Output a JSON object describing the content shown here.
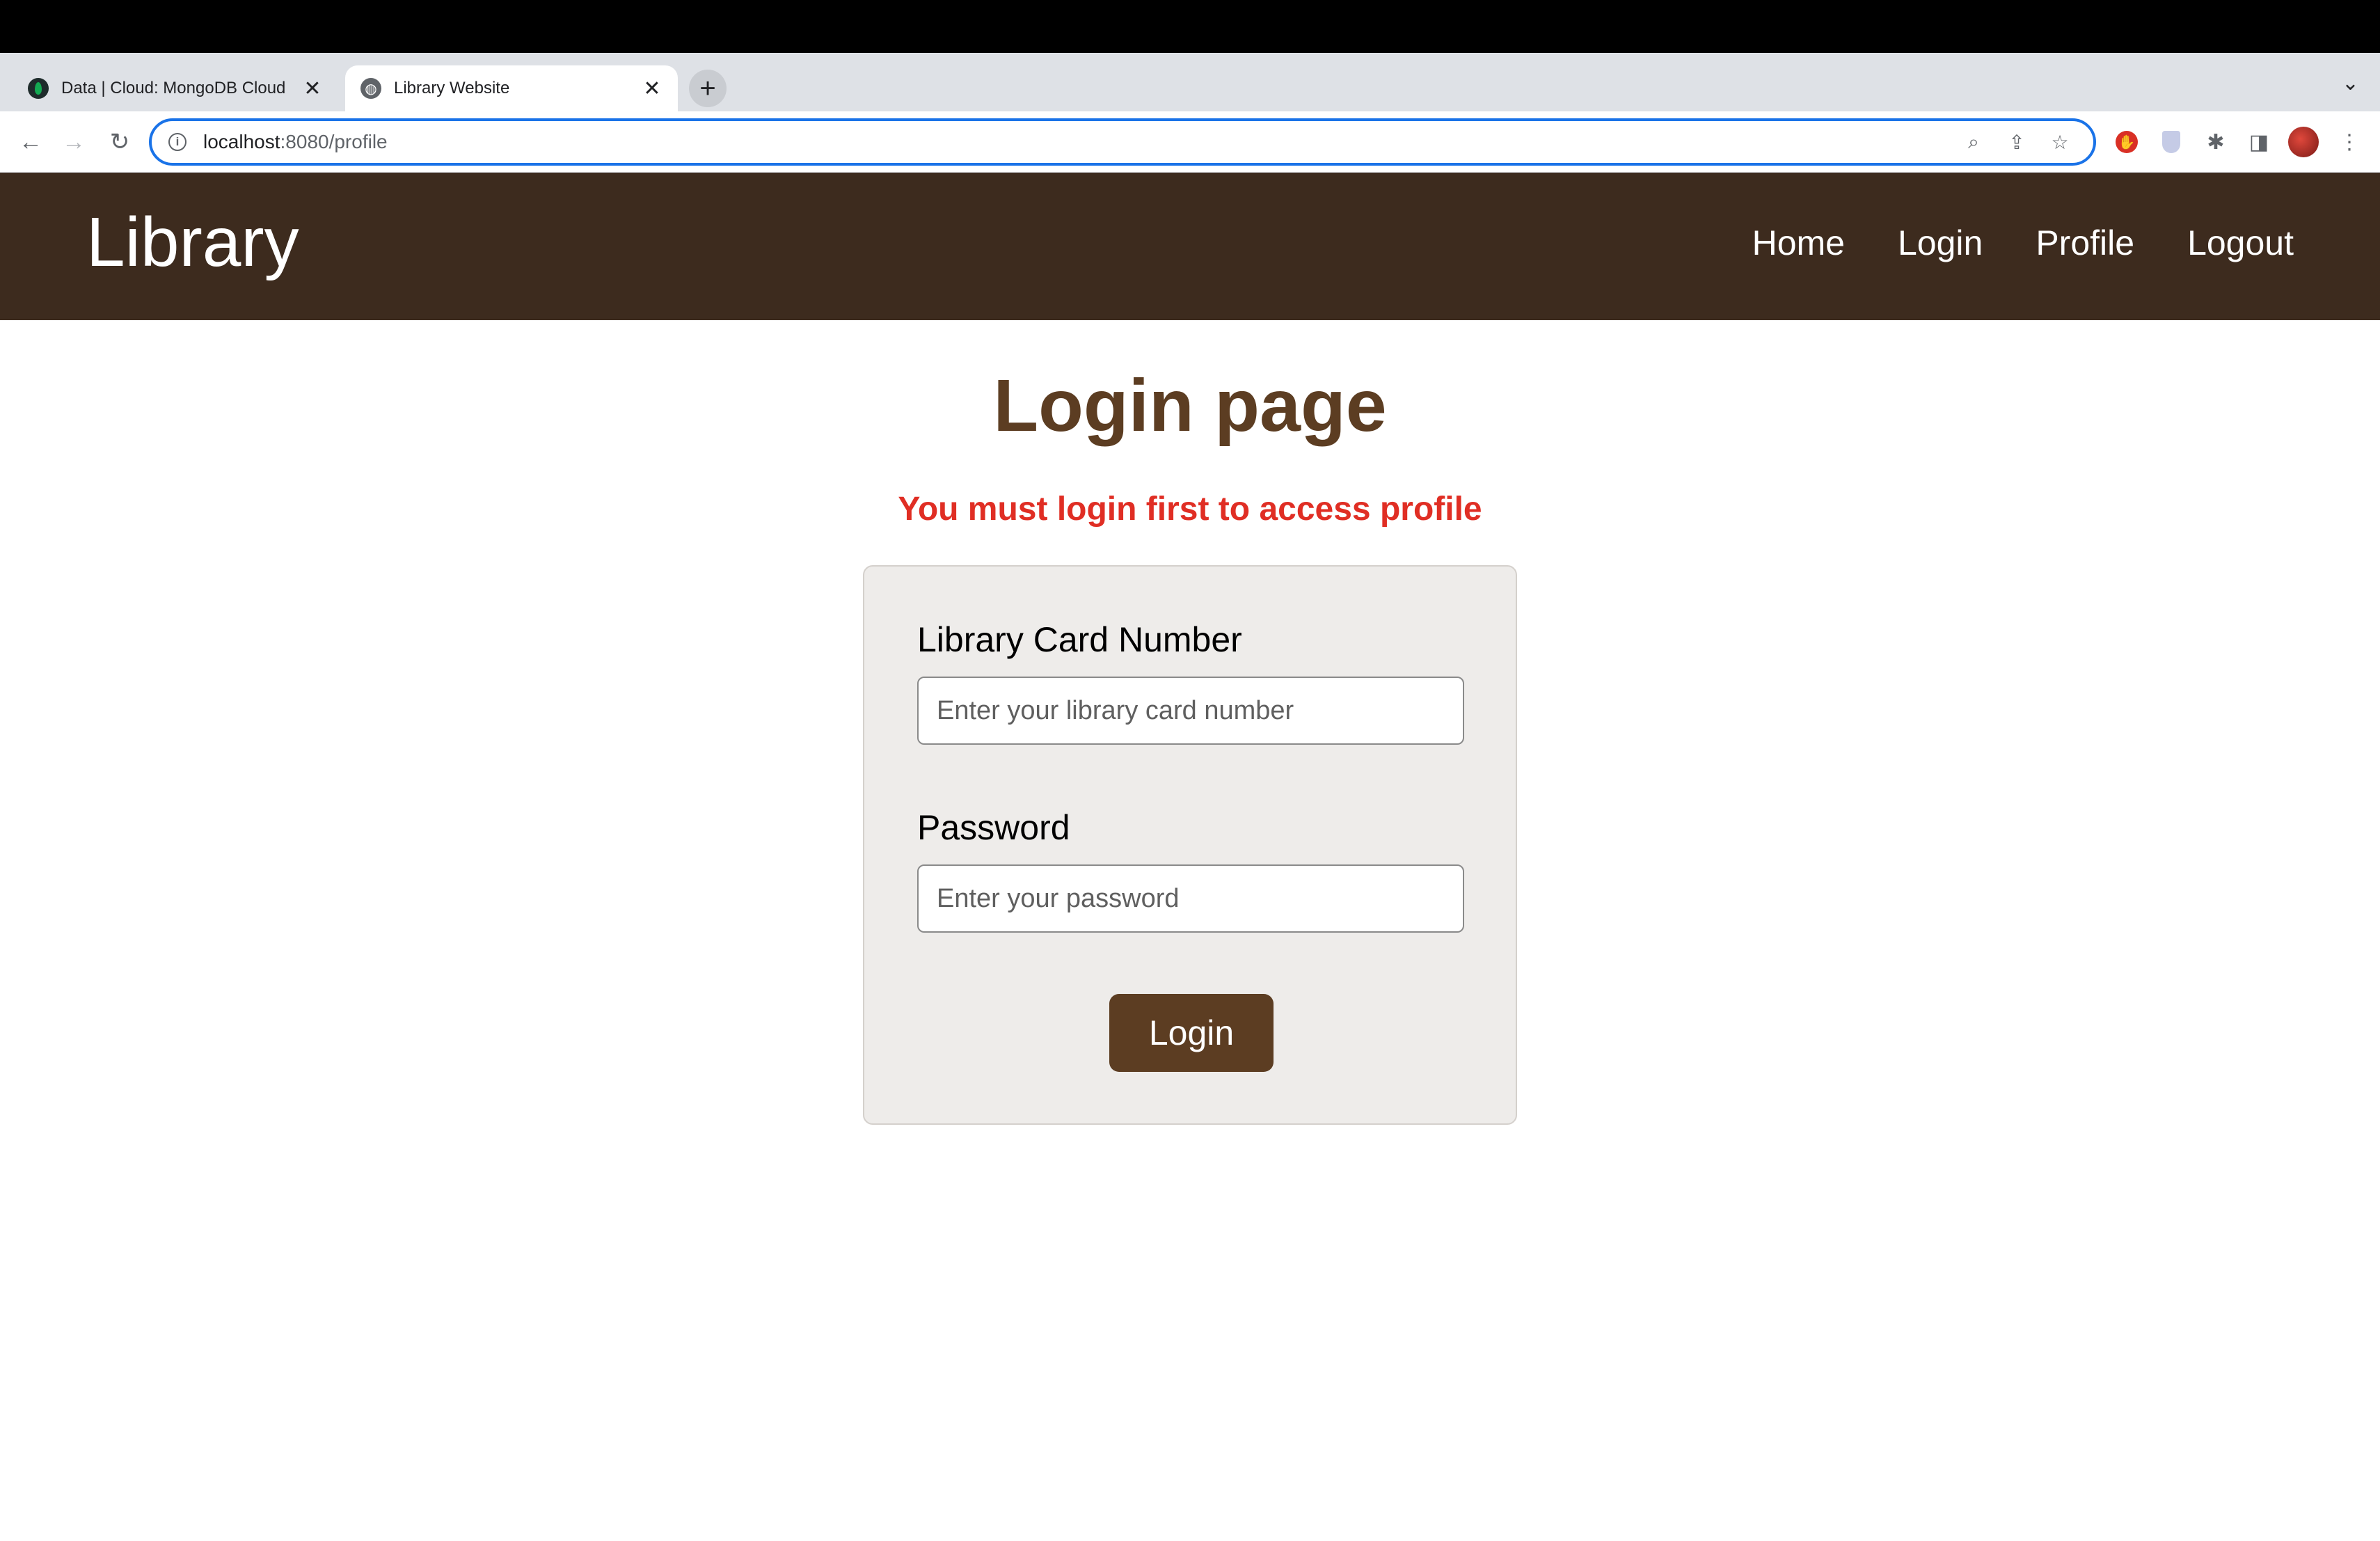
{
  "browser": {
    "tabs": [
      {
        "label": "Data | Cloud: MongoDB Cloud",
        "icon": "mongodb-leaf-icon",
        "active": false
      },
      {
        "label": "Library Website",
        "icon": "globe-icon",
        "active": true
      }
    ],
    "close_glyph": "✕",
    "new_tab_glyph": "+",
    "tab_menu_glyph": "⌄",
    "url_host": "localhost",
    "url_rest": ":8080/profile"
  },
  "site": {
    "brand": "Library",
    "nav": [
      "Home",
      "Login",
      "Profile",
      "Logout"
    ]
  },
  "page": {
    "title": "Login page",
    "error": "You must login first to access profile",
    "card_label": "Library Card Number",
    "card_placeholder": "Enter your library card number",
    "card_value": "",
    "password_label": "Password",
    "password_placeholder": "Enter your password",
    "password_value": "",
    "submit_label": "Login"
  },
  "colors": {
    "header_bg": "#3d2b1e",
    "accent_brown": "#5c3d22",
    "error_red": "#e02e24",
    "card_bg": "#eeecea",
    "omnibox_focus": "#1a73e8"
  }
}
